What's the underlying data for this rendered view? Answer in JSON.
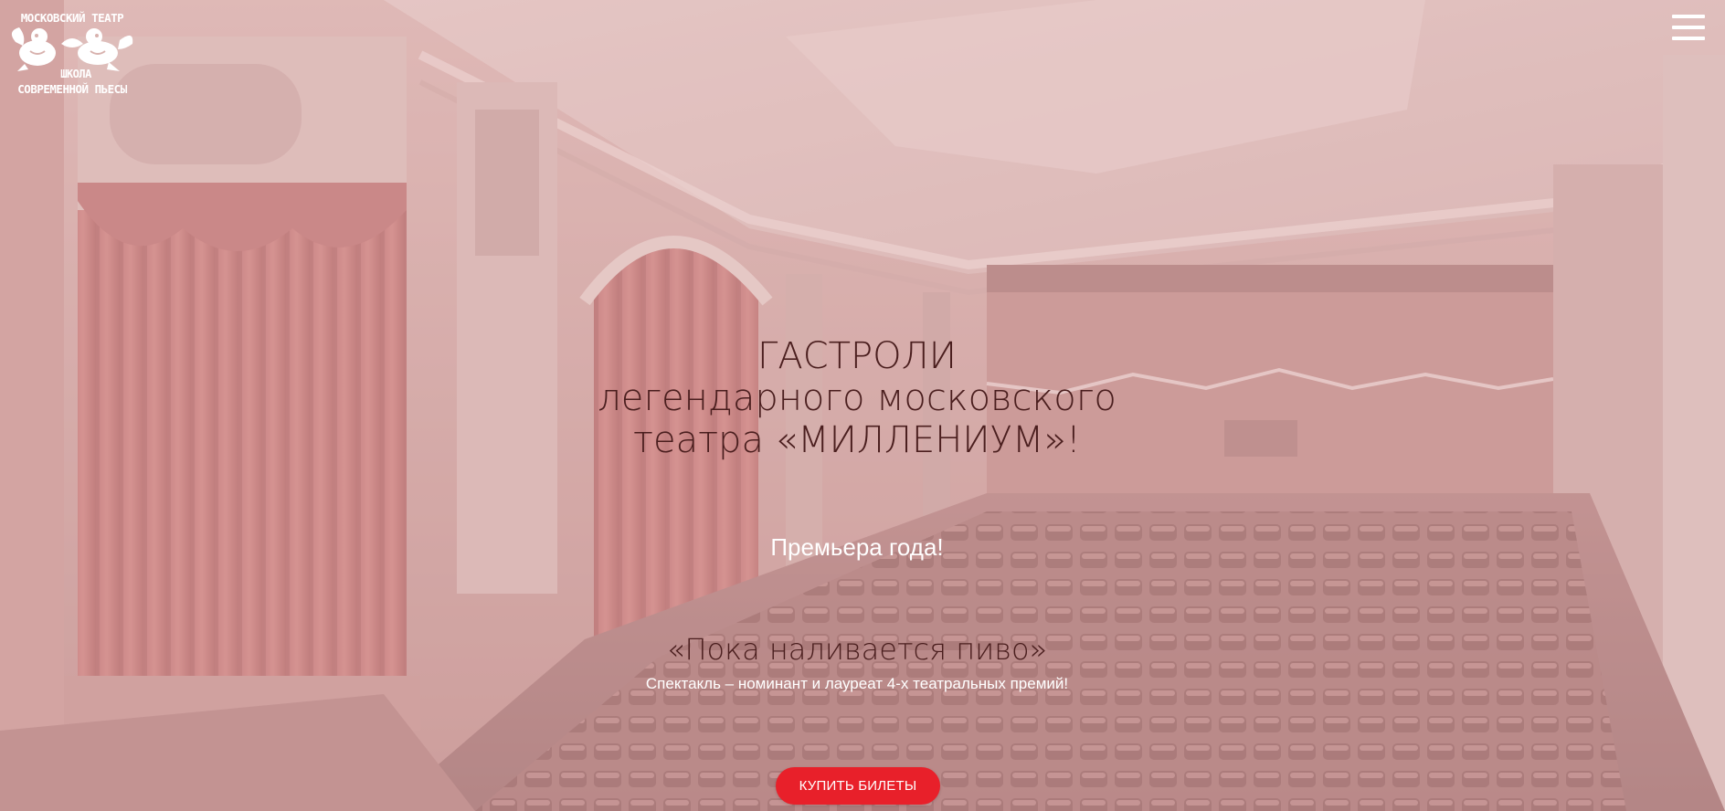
{
  "header": {
    "logo": {
      "line1": "МОСКОВСКИЙ ТЕАТР",
      "line2": "ШКОЛА",
      "line3": "СОВРЕМЕННОЙ ПЬЕСЫ"
    },
    "menu_icon": "hamburger-menu-icon"
  },
  "hero": {
    "headline": {
      "line1": "ГАСТРОЛИ",
      "line2": "легендарного московского",
      "line3": "театра «МИЛЛЕНИУМ»!"
    },
    "premiere": "Премьера года!",
    "play_title": "«Пока наливается пиво»",
    "play_subtitle": "Спектакль – номинант и лауреат 4-х театральных премий!",
    "cta_label": "КУПИТЬ БИЛЕТЫ"
  },
  "colors": {
    "accent": "#e8202a",
    "heading_text": "#4a1e1e",
    "overlay": "#e8c4c4"
  }
}
